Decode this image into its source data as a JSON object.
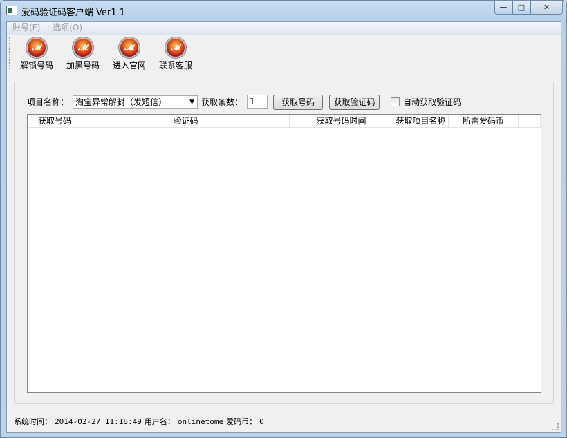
{
  "window": {
    "title": "爱码验证码客户端 Ver1.1",
    "minimize": "—",
    "maximize": "□",
    "close": "✕"
  },
  "menu": [
    {
      "label": "账号(F)"
    },
    {
      "label": "选项(O)"
    }
  ],
  "toolbar": [
    {
      "label": "解锁号码",
      "icon": "fire-logo-icon"
    },
    {
      "label": "加黑号码",
      "icon": "fire-logo-icon"
    },
    {
      "label": "进入官网",
      "icon": "fire-logo-icon"
    },
    {
      "label": "联系客服",
      "icon": "fire-logo-icon"
    }
  ],
  "form": {
    "project_label": "项目名称：",
    "project_value": "淘宝异常解封（发短信）",
    "count_label": "获取条数：",
    "count_value": "1",
    "get_number_button": "获取号码",
    "get_code_button": "获取验证码",
    "auto_checkbox_label": "自动获取验证码",
    "auto_checked": false
  },
  "table": {
    "columns": [
      "获取号码",
      "验证码",
      "获取号码时间",
      "获取项目名称",
      "所需爱码币"
    ],
    "rows": []
  },
  "status": {
    "time_label": "系统时间：",
    "time_value": "2014-02-27 11:18:49",
    "user_label": "用户名：",
    "user_value": "onlinetome",
    "coin_label": "爱码币：",
    "coin_value": "0"
  }
}
